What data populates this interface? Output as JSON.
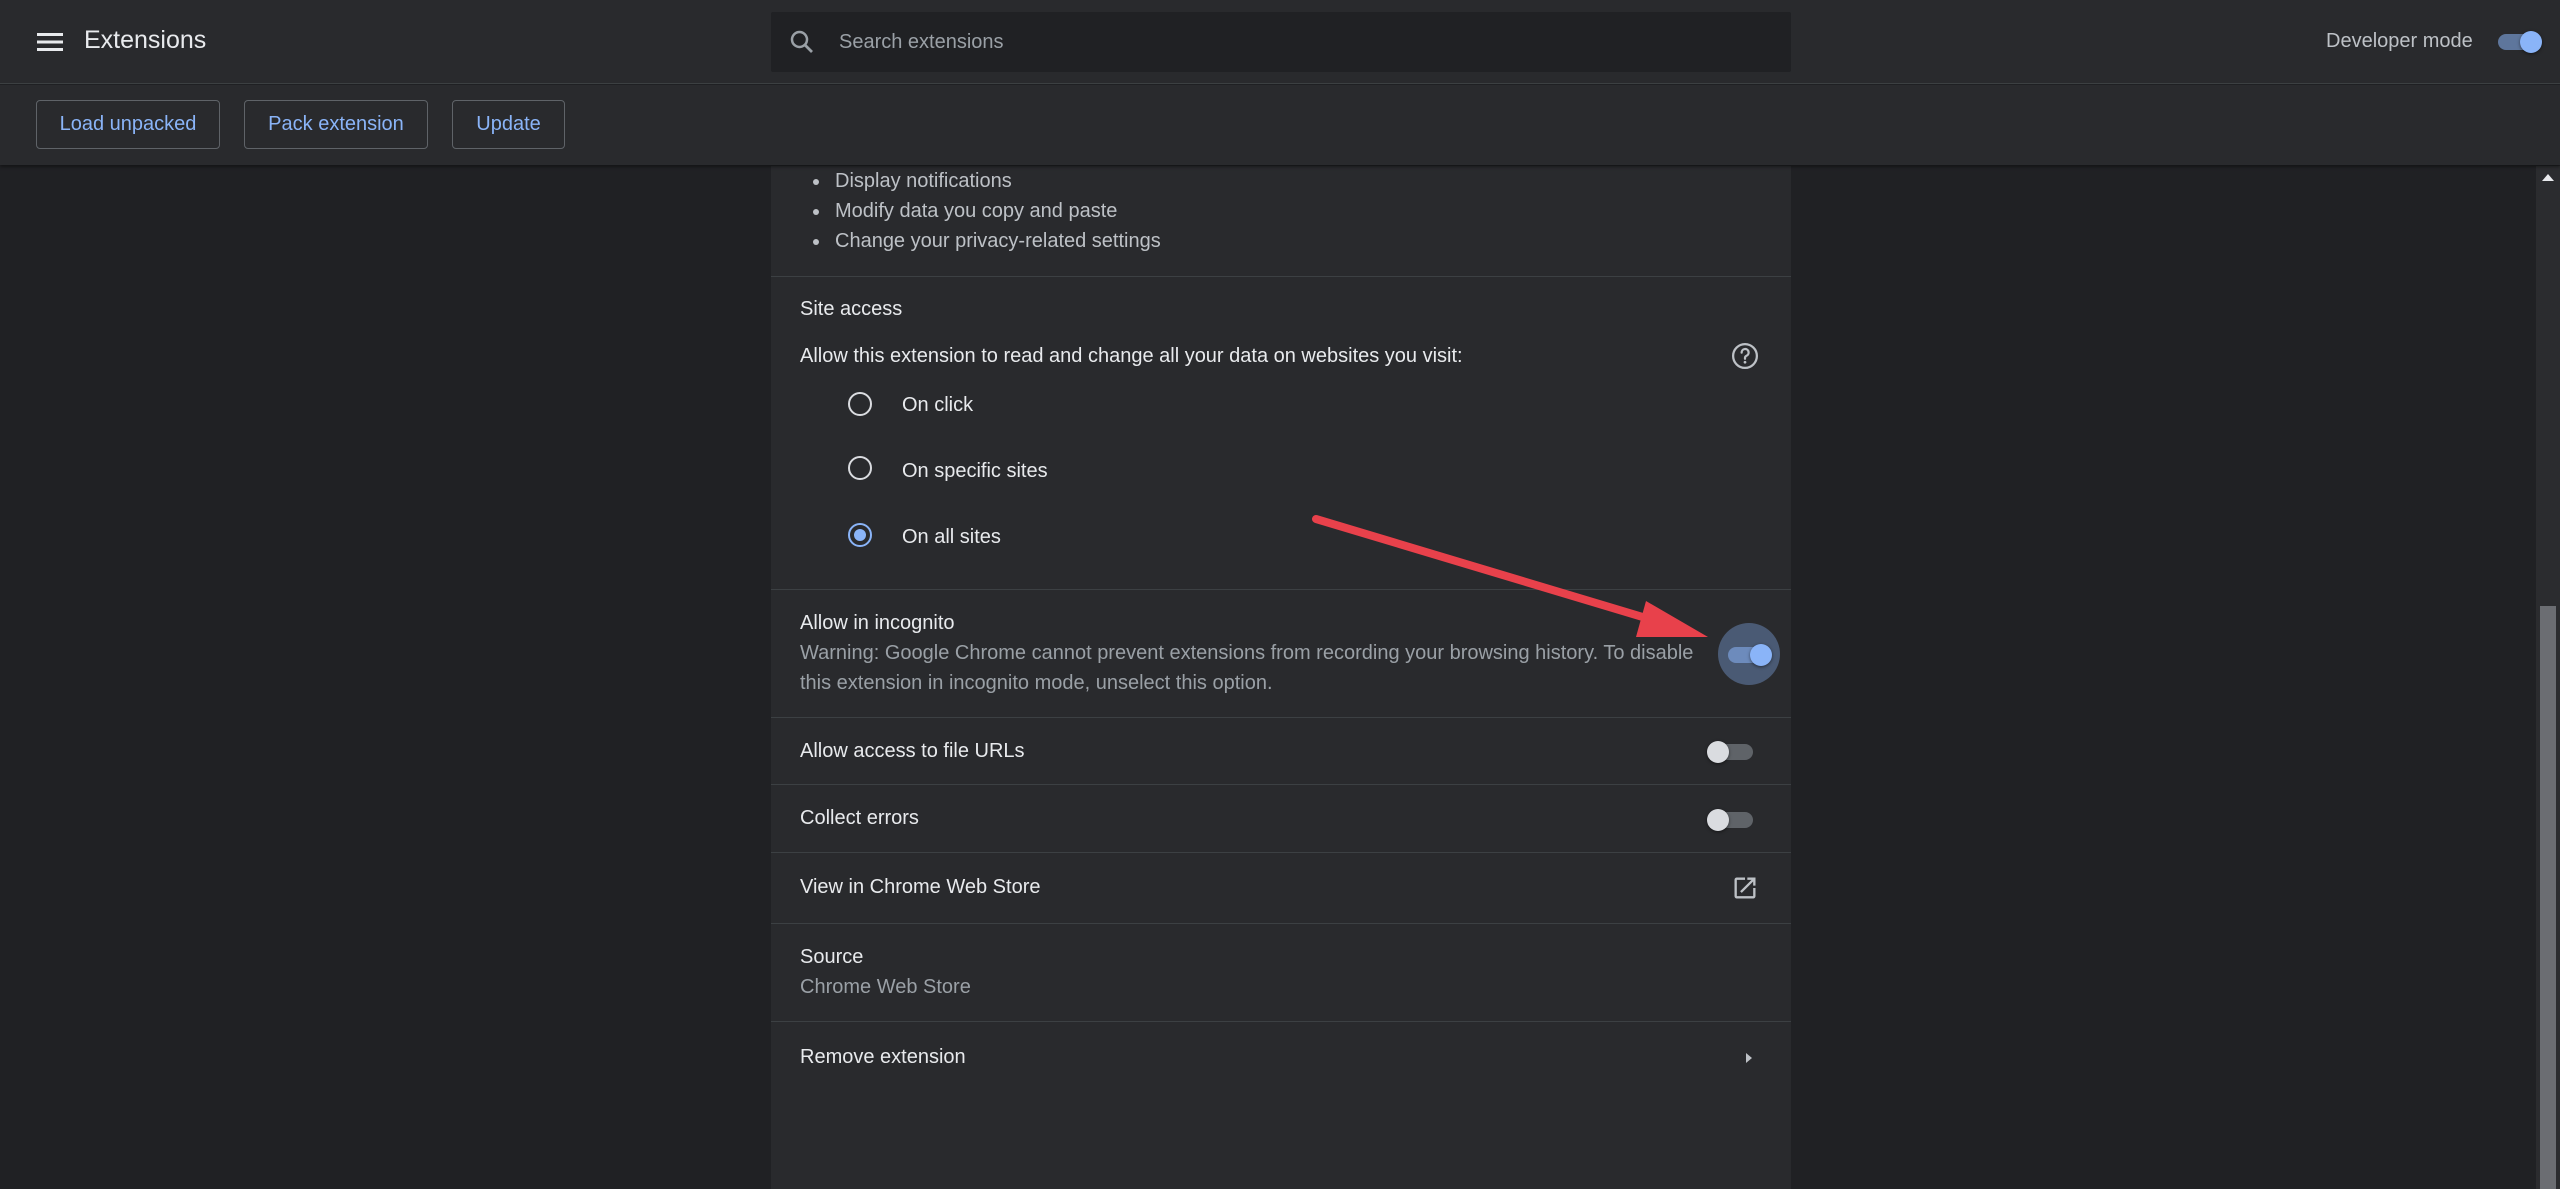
{
  "header": {
    "title": "Extensions",
    "search_placeholder": "Search extensions",
    "developer_mode_label": "Developer mode",
    "developer_mode_on": true
  },
  "toolbar": {
    "load_unpacked": "Load unpacked",
    "pack_extension": "Pack extension",
    "update": "Update"
  },
  "permissions": [
    "Display notifications",
    "Modify data you copy and paste",
    "Change your privacy-related settings"
  ],
  "site_access": {
    "heading": "Site access",
    "description": "Allow this extension to read and change all your data on websites you visit:",
    "options": [
      {
        "label": "On click",
        "selected": false
      },
      {
        "label": "On specific sites",
        "selected": false
      },
      {
        "label": "On all sites",
        "selected": true
      }
    ]
  },
  "incognito": {
    "label": "Allow in incognito",
    "warning_line1": "Warning: Google Chrome cannot prevent extensions from recording your browsing history. To disable",
    "warning_line2": "this extension in incognito mode, unselect this option.",
    "enabled": true
  },
  "file_urls": {
    "label": "Allow access to file URLs",
    "enabled": false
  },
  "collect_errors": {
    "label": "Collect errors",
    "enabled": false
  },
  "web_store": {
    "label": "View in Chrome Web Store"
  },
  "source": {
    "label": "Source",
    "value": "Chrome Web Store"
  },
  "remove": {
    "label": "Remove extension"
  },
  "colors": {
    "accent": "#8ab4f8",
    "background": "#202124",
    "surface": "#292a2d",
    "annotation_arrow": "#e8414b"
  }
}
